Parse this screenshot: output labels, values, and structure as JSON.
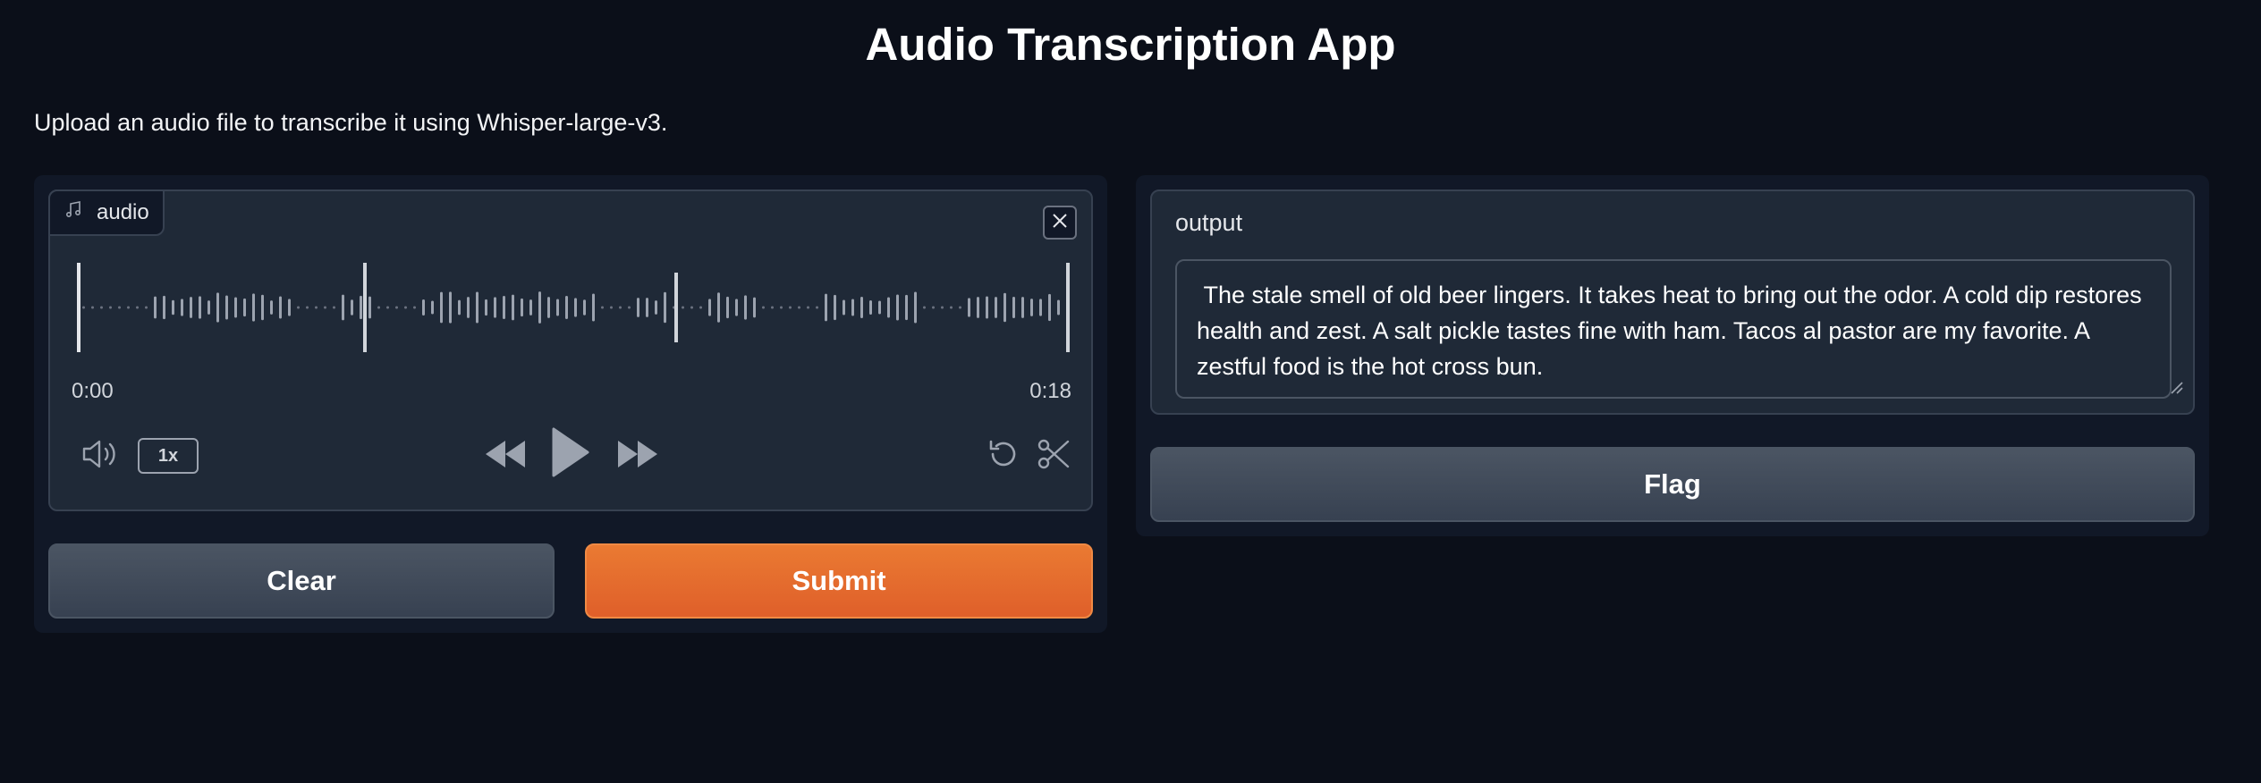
{
  "page": {
    "title": "Audio Transcription App",
    "description": "Upload an audio file to transcribe it using Whisper-large-v3."
  },
  "audio": {
    "label": "audio",
    "label_icon": "music-note-icon",
    "time_start": "0:00",
    "time_end": "0:18",
    "playback_rate": "1x",
    "playhead_fraction": 0
  },
  "buttons": {
    "clear": "Clear",
    "submit": "Submit",
    "flag": "Flag"
  },
  "output": {
    "label": "output",
    "text": " The stale smell of old beer lingers. It takes heat to bring out the odor. A cold dip restores health and zest. A salt pickle tastes fine with ham. Tacos al pastor are my favorite. A zestful food is the hot cross bun."
  },
  "icons": [
    "music-note-icon",
    "close-icon",
    "volume-icon",
    "rewind-icon",
    "play-icon",
    "fast-forward-icon",
    "undo-icon",
    "scissors-icon",
    "resize-grip-icon"
  ],
  "colors": {
    "background": "#0b0f19",
    "panel": "#111827",
    "accent": "#ea7a32",
    "secondary_button": "#4b5563"
  }
}
